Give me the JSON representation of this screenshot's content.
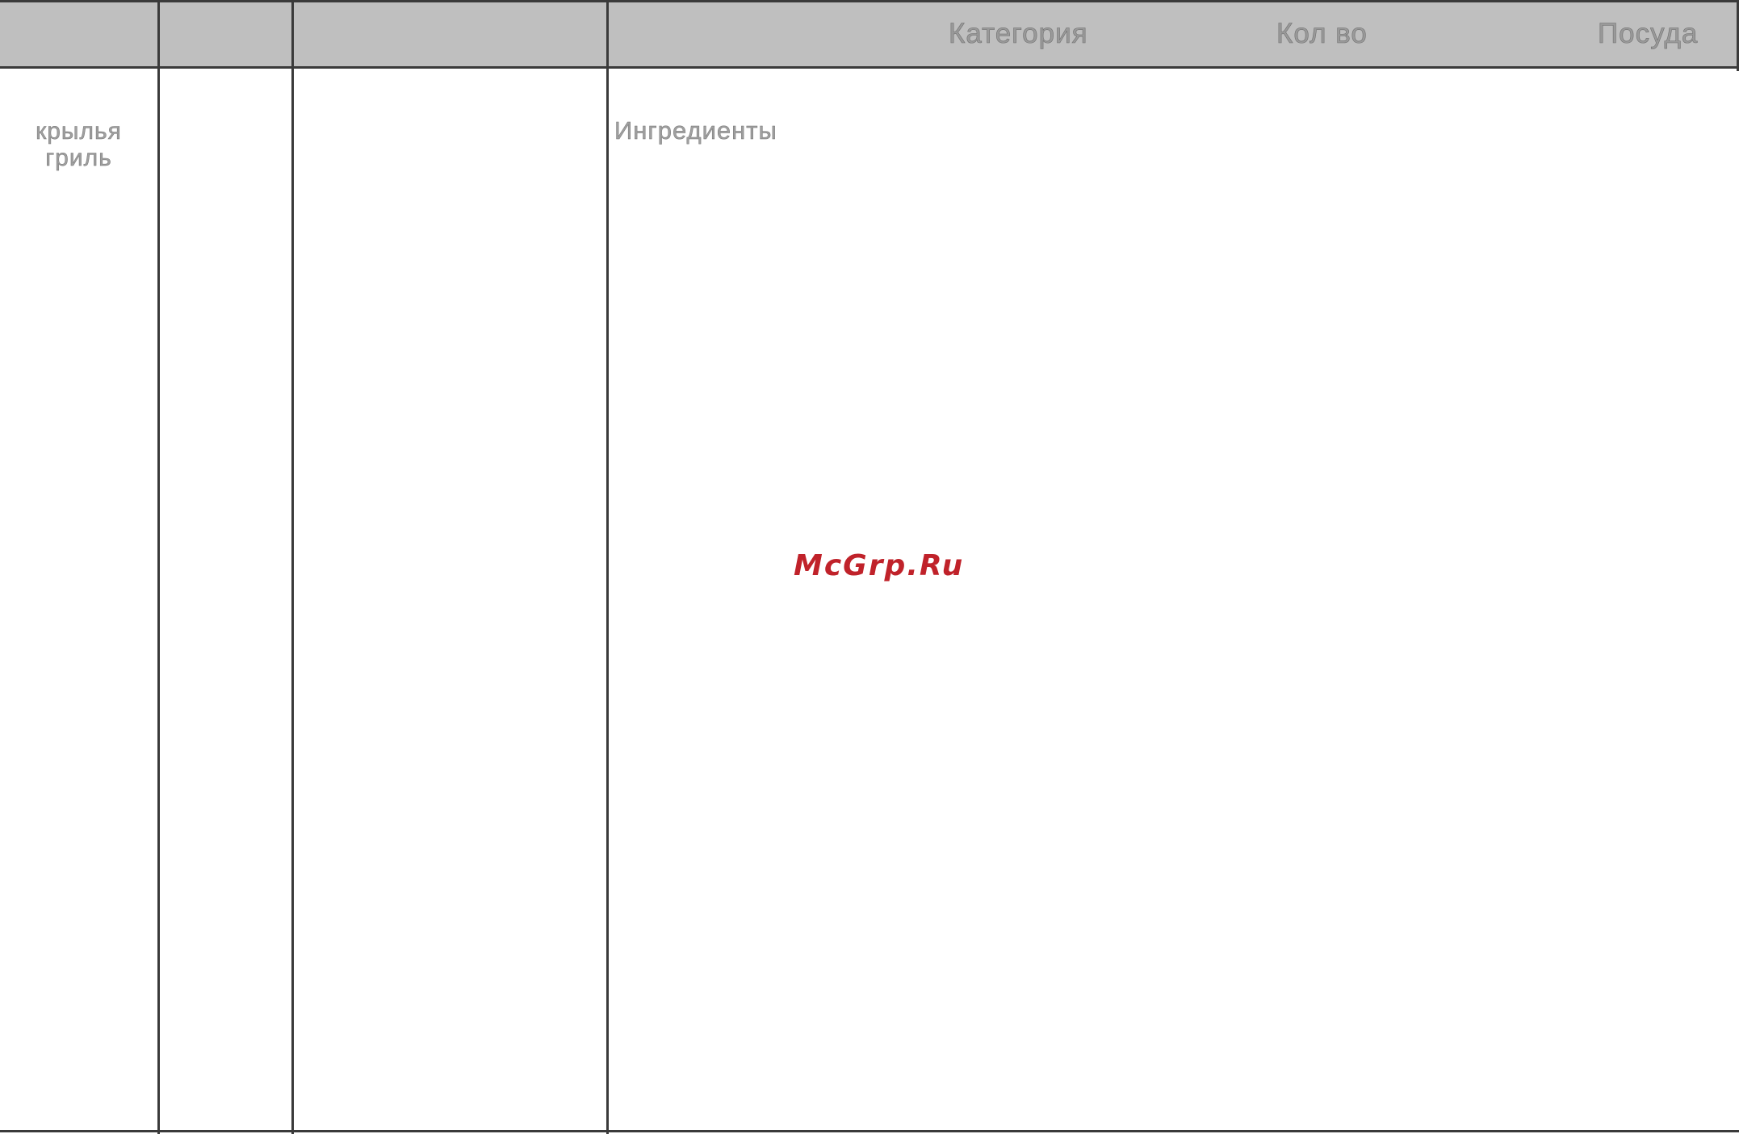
{
  "header": {
    "category_label": "Категория",
    "quantity_label": "Кол во",
    "dishware_label": "Посуда"
  },
  "row": {
    "dish_name_line1": "крылья",
    "dish_name_line2": "гриль",
    "ingredients_label": "Ингредиенты"
  },
  "watermark": {
    "text": "McGrp.Ru",
    "color": "#c0222a"
  },
  "colors": {
    "header_fill": "#bfbfbf",
    "rule": "#3a3a3a",
    "text_gray": "#9a9a9a"
  }
}
